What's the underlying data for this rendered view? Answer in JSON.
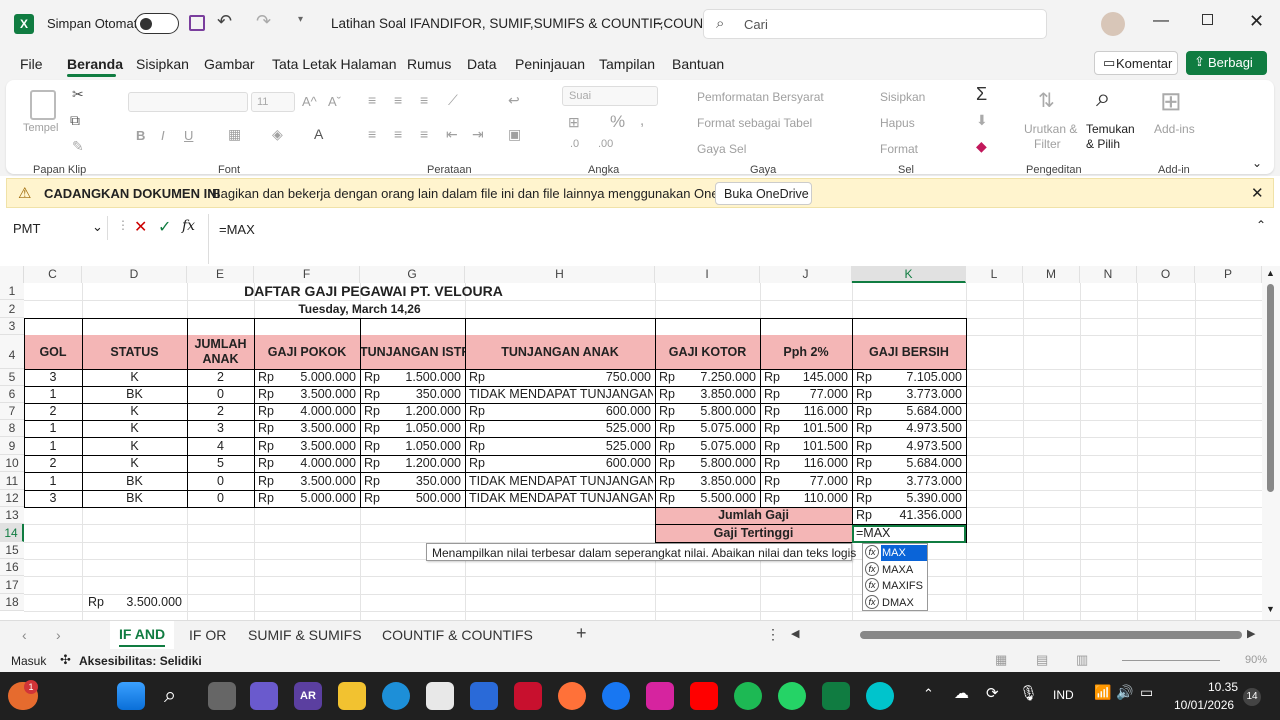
{
  "titlebar": {
    "autosave_label": "Simpan Otomatis",
    "doc_title": "Latihan Soal IFANDIFOR, SUMIF,SUMIFS & COUNTIF,COUN...",
    "search_placeholder": "Cari"
  },
  "menu": {
    "items": [
      "File",
      "Beranda",
      "Sisipkan",
      "Gambar",
      "Tata Letak Halaman",
      "Rumus",
      "Data",
      "Peninjauan",
      "Tampilan",
      "Bantuan"
    ],
    "comment_button": "Komentar",
    "share_button": "Berbagi"
  },
  "ribbon": {
    "paste": "Tempel",
    "clipboard_group": "Papan Klip",
    "font_size": "11",
    "font_group": "Font",
    "alignment_group": "Perataan",
    "number_format": "Suai",
    "number_group": "Angka",
    "conditional_format": "Pemformatan Bersyarat",
    "format_table": "Format sebagai Tabel",
    "cell_styles": "Gaya Sel",
    "styles_group": "Gaya",
    "insert": "Sisipkan",
    "delete": "Hapus",
    "format": "Format",
    "cells_group": "Sel",
    "sort_filter_1": "Urutkan &",
    "sort_filter_2": "Filter",
    "find_select_1": "Temukan",
    "find_select_2": "& Pilih",
    "editing_group": "Pengeditan",
    "addins": "Add-ins",
    "addins_group": "Add-in"
  },
  "notice": {
    "title": "CADANGKAN DOKUMEN INI",
    "message": "Bagikan dan bekerja dengan orang lain dalam file ini dan file lainnya menggunakan OneDrive.",
    "button": "Buka OneDrive"
  },
  "formula_bar": {
    "name_box": "PMT",
    "formula": "=MAX"
  },
  "columns": [
    "C",
    "D",
    "E",
    "F",
    "G",
    "H",
    "I",
    "J",
    "K",
    "L",
    "M",
    "N",
    "O",
    "P"
  ],
  "rows": [
    "1",
    "2",
    "3",
    "4",
    "5",
    "6",
    "7",
    "8",
    "9",
    "10",
    "11",
    "12",
    "13",
    "14",
    "15",
    "16",
    "17",
    "18"
  ],
  "sheet": {
    "title": "DAFTAR GAJI PEGAWAI PT. VELOURA",
    "date": "Tuesday, March 14,26",
    "headers": {
      "gol": "GOL",
      "status": "STATUS",
      "jumlah_anak_1": "JUMLAH",
      "jumlah_anak_2": "ANAK",
      "gaji_pokok": "GAJI POKOK",
      "tunjangan_istri": "TUNJANGAN ISTRI",
      "tunjangan_anak": "TUNJANGAN ANAK",
      "gaji_kotor": "GAJI KOTOR",
      "pph": "Pph 2%",
      "gaji_bersih": "GAJI BERSIH"
    },
    "currency": "Rp",
    "data_rows": [
      {
        "gol": "3",
        "status": "K",
        "anak": "2",
        "pokok": "5.000.000",
        "istri": "1.500.000",
        "anak_tunj": "750.000",
        "kotor": "7.250.000",
        "pph": "145.000",
        "bersih": "7.105.000"
      },
      {
        "gol": "1",
        "status": "BK",
        "anak": "0",
        "pokok": "3.500.000",
        "istri": "350.000",
        "anak_tunj": "TIDAK MENDAPAT TUNJANGAN",
        "kotor": "3.850.000",
        "pph": "77.000",
        "bersih": "3.773.000"
      },
      {
        "gol": "2",
        "status": "K",
        "anak": "2",
        "pokok": "4.000.000",
        "istri": "1.200.000",
        "anak_tunj": "600.000",
        "kotor": "5.800.000",
        "pph": "116.000",
        "bersih": "5.684.000"
      },
      {
        "gol": "1",
        "status": "K",
        "anak": "3",
        "pokok": "3.500.000",
        "istri": "1.050.000",
        "anak_tunj": "525.000",
        "kotor": "5.075.000",
        "pph": "101.500",
        "bersih": "4.973.500"
      },
      {
        "gol": "1",
        "status": "K",
        "anak": "4",
        "pokok": "3.500.000",
        "istri": "1.050.000",
        "anak_tunj": "525.000",
        "kotor": "5.075.000",
        "pph": "101.500",
        "bersih": "4.973.500"
      },
      {
        "gol": "2",
        "status": "K",
        "anak": "5",
        "pokok": "4.000.000",
        "istri": "1.200.000",
        "anak_tunj": "600.000",
        "kotor": "5.800.000",
        "pph": "116.000",
        "bersih": "5.684.000"
      },
      {
        "gol": "1",
        "status": "BK",
        "anak": "0",
        "pokok": "3.500.000",
        "istri": "350.000",
        "anak_tunj": "TIDAK MENDAPAT TUNJANGAN",
        "kotor": "3.850.000",
        "pph": "77.000",
        "bersih": "3.773.000"
      },
      {
        "gol": "3",
        "status": "BK",
        "anak": "0",
        "pokok": "5.000.000",
        "istri": "500.000",
        "anak_tunj": "TIDAK MENDAPAT TUNJANGAN",
        "kotor": "5.500.000",
        "pph": "110.000",
        "bersih": "5.390.000"
      }
    ],
    "total_label": "Jumlah Gaji",
    "total_value": "41.356.000",
    "max_label": "Gaji Tertinggi",
    "max_formula": "=MAX",
    "row18_value": "3.500.000"
  },
  "autocomplete": {
    "tooltip": "Menampilkan nilai terbesar dalam seperangkat nilai. Abaikan nilai dan teks logis",
    "options": [
      "MAX",
      "MAXA",
      "MAXIFS",
      "DMAX"
    ]
  },
  "tabs": {
    "sheets": [
      "IF AND",
      "IF OR",
      "SUMIF & SUMIFS",
      "COUNTIF & COUNTIFS"
    ],
    "active": "IF AND"
  },
  "statusbar": {
    "mode": "Masuk",
    "accessibility": "Aksesibilitas: Selidiki",
    "zoom": "90%"
  },
  "taskbar": {
    "lang": "IND",
    "time": "10.35",
    "date": "10/01/2026",
    "notif_count": "14"
  }
}
